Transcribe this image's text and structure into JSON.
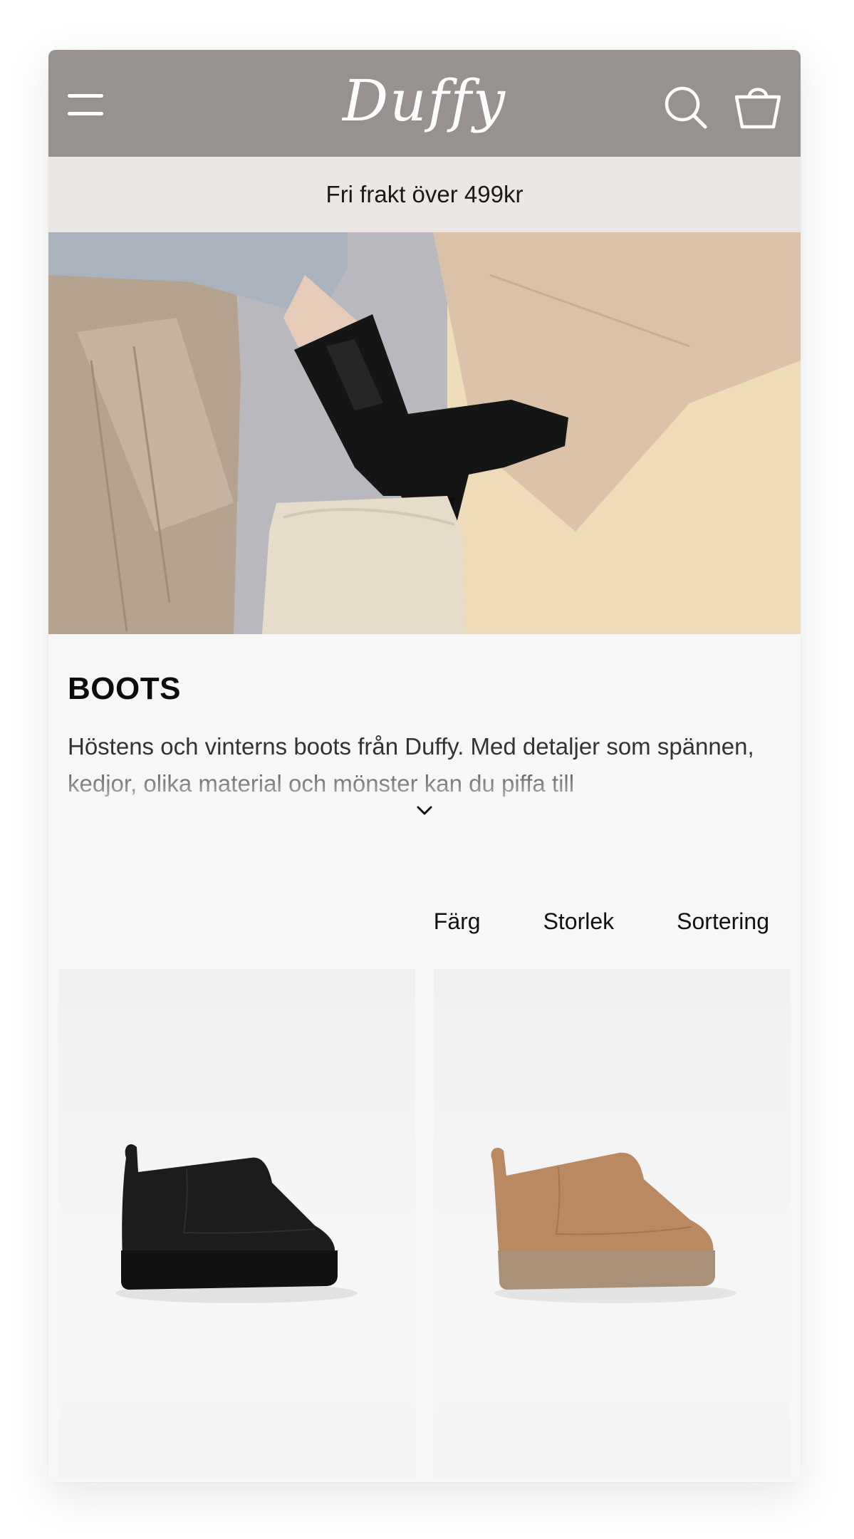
{
  "header": {
    "logo_text": "Duffy",
    "brand_color": "#979290",
    "icons": [
      "menu-icon",
      "search-icon",
      "shopping-bag-icon"
    ]
  },
  "promo_banner": {
    "text": "Fri frakt över 499kr"
  },
  "hero": {
    "image": "black-chelsea-boot-on-stool"
  },
  "category": {
    "title": "BOOTS",
    "description": "Höstens och vinterns boots från Duffy. Med detaljer som spännen, kedjor, olika material och mönster kan du piffa till",
    "expand_icon": "chevron-down-icon"
  },
  "filters": {
    "color_label": "Färg",
    "size_label": "Storlek",
    "sort_label": "Sortering"
  },
  "products": [
    {
      "image": "black-platform-mini-boot",
      "color": "#1b1b1c"
    },
    {
      "image": "tan-platform-mini-boot",
      "color": "#b98a62"
    }
  ]
}
